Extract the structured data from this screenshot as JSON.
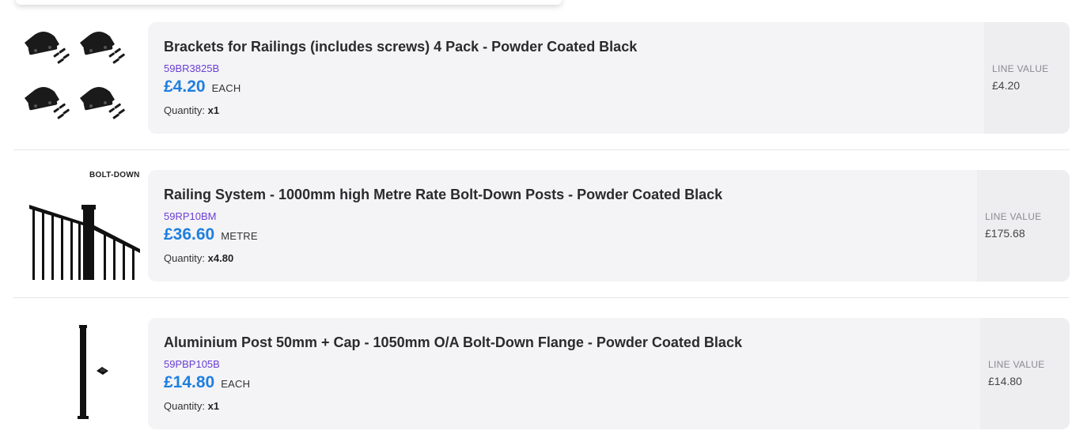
{
  "items": [
    {
      "title": "Brackets for Railings (includes screws) 4 Pack - Powder Coated Black",
      "sku": "59BR3825B",
      "price": "£4.20",
      "unit": "EACH",
      "quantity_label": "Quantity:",
      "quantity": "x1",
      "line_value_label": "LINE VALUE",
      "line_value": "£4.20",
      "image_icon": "bracket-pack-icon"
    },
    {
      "title": "Railing System - 1000mm high Metre Rate Bolt-Down Posts - Powder Coated Black",
      "sku": "59RP10BM",
      "price": "£36.60",
      "unit": "METRE",
      "quantity_label": "Quantity:",
      "quantity": "x4.80",
      "line_value_label": "LINE VALUE",
      "line_value": "£175.68",
      "image_badge": "BOLT-DOWN",
      "image_icon": "railing-system-icon"
    },
    {
      "title": "Aluminium Post 50mm + Cap - 1050mm O/A Bolt-Down Flange - Powder Coated Black",
      "sku": "59PBP105B",
      "price": "£14.80",
      "unit": "EACH",
      "quantity_label": "Quantity:",
      "quantity": "x1",
      "line_value_label": "LINE VALUE",
      "line_value": "£14.80",
      "image_icon": "aluminium-post-icon"
    }
  ],
  "colors": {
    "price": "#1e7fe0",
    "sku": "#6a3fd6",
    "card_bg": "#f4f4f6",
    "line_value_bg": "#eeeef1"
  }
}
